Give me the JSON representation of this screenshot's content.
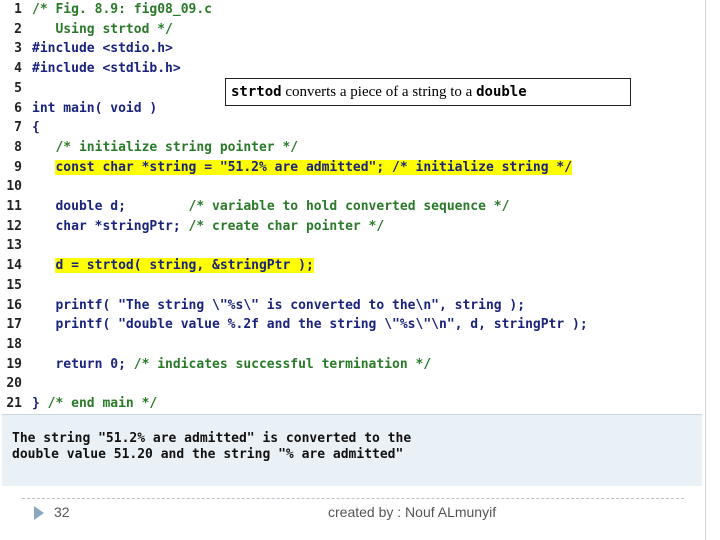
{
  "code": {
    "lines": [
      {
        "n": "1",
        "segs": [
          {
            "t": "/* Fig. 8.9: fig08_09.c",
            "c": "cm"
          }
        ]
      },
      {
        "n": "2",
        "segs": [
          {
            "t": "   Using strtod */",
            "c": "cm"
          }
        ]
      },
      {
        "n": "3",
        "segs": [
          {
            "t": "#include <stdio.h>",
            "c": "pp"
          }
        ]
      },
      {
        "n": "4",
        "segs": [
          {
            "t": "#include <stdlib.h>",
            "c": "pp"
          }
        ]
      },
      {
        "n": "5",
        "segs": []
      },
      {
        "n": "6",
        "segs": [
          {
            "t": "int main( void )",
            "c": "pl"
          }
        ]
      },
      {
        "n": "7",
        "segs": [
          {
            "t": "{",
            "c": "pl"
          }
        ]
      },
      {
        "n": "8",
        "segs": [
          {
            "t": "   /* initialize string pointer */",
            "c": "cm"
          }
        ]
      },
      {
        "n": "9",
        "hl": true,
        "segs": [
          {
            "t": "   ",
            "c": "pl"
          },
          {
            "t": "const char *string = \"51.2% are admitted\"; /* initialize string */",
            "c": "pl",
            "h": true
          }
        ]
      },
      {
        "n": "10",
        "segs": []
      },
      {
        "n": "11",
        "segs": [
          {
            "t": "   double d;        ",
            "c": "pl"
          },
          {
            "t": "/* variable to hold converted sequence */",
            "c": "cm"
          }
        ]
      },
      {
        "n": "12",
        "segs": [
          {
            "t": "   char *stringPtr; ",
            "c": "pl"
          },
          {
            "t": "/* create char pointer */",
            "c": "cm"
          }
        ]
      },
      {
        "n": "13",
        "segs": []
      },
      {
        "n": "14",
        "segs": [
          {
            "t": "   ",
            "c": "pl"
          },
          {
            "t": "d = strtod( string, &stringPtr );",
            "c": "pl",
            "h": true
          }
        ]
      },
      {
        "n": "15",
        "segs": []
      },
      {
        "n": "16",
        "segs": [
          {
            "t": "   printf( \"The string \\\"%s\\\" is converted to the\\n\", string );",
            "c": "pl"
          }
        ]
      },
      {
        "n": "17",
        "segs": [
          {
            "t": "   printf( \"double value %.2f and the string \\\"%s\\\"\\n\", d, stringPtr );",
            "c": "pl"
          }
        ]
      },
      {
        "n": "18",
        "segs": []
      },
      {
        "n": "19",
        "segs": [
          {
            "t": "   return 0; ",
            "c": "pl"
          },
          {
            "t": "/* indicates successful termination */",
            "c": "cm"
          }
        ]
      },
      {
        "n": "20",
        "segs": []
      },
      {
        "n": "21",
        "segs": [
          {
            "t": "} ",
            "c": "pl"
          },
          {
            "t": "/* end main */",
            "c": "cm"
          }
        ]
      }
    ]
  },
  "callout": {
    "code1": "strtod",
    "text": " converts a piece of a string to a ",
    "code2": "double"
  },
  "output": {
    "line1": "The string \"51.2% are admitted\" is converted to the",
    "line2": "double value 51.20 and the string \"% are admitted\""
  },
  "footer": {
    "page": "32",
    "credit": "created by : Nouf ALmunyif"
  },
  "colors": {
    "highlight": "#ffff00",
    "comment": "#2a7a2a",
    "code": "#1a237e",
    "output_bg": "#eaf1f6"
  }
}
